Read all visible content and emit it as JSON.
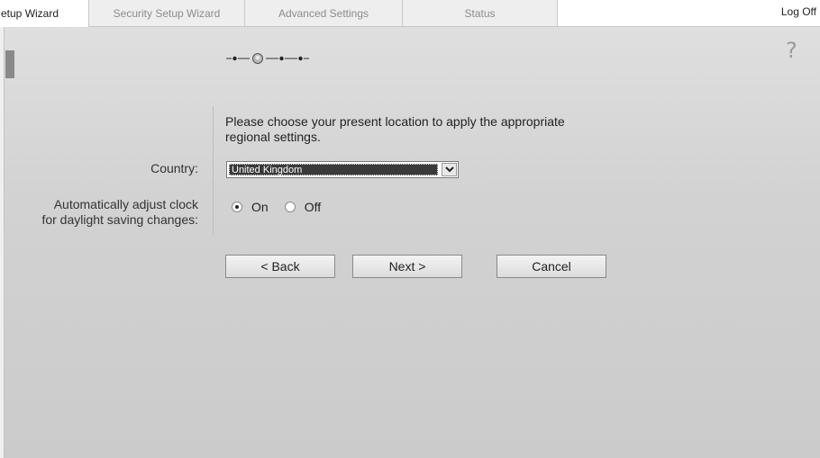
{
  "tabs": [
    {
      "label": "etup Wizard",
      "active": true
    },
    {
      "label": "Security Setup Wizard",
      "active": false
    },
    {
      "label": "Advanced Settings",
      "active": false
    },
    {
      "label": "Status",
      "active": false
    }
  ],
  "header": {
    "logoff_label": "Log Off"
  },
  "help": {
    "icon": "question-mark-icon",
    "glyph": "?"
  },
  "wizard": {
    "progress": {
      "total_steps": 5,
      "current_step": 2
    },
    "instruction": "Please choose your present location to apply the appropriate regional settings.",
    "country": {
      "label": "Country:",
      "value": "United Kingdom"
    },
    "dst": {
      "label_line1": "Automatically adjust clock",
      "label_line2": "for daylight saving changes:",
      "options": [
        {
          "label": "On",
          "checked": true
        },
        {
          "label": "Off",
          "checked": false
        }
      ]
    },
    "buttons": {
      "back": "< Back",
      "next": "Next >",
      "cancel": "Cancel"
    }
  },
  "colors": {
    "background": "#d2d2d2",
    "tab_active": "#ffffff",
    "tab_inactive": "#eeeeee",
    "select_highlight": "#3a3a3a"
  }
}
